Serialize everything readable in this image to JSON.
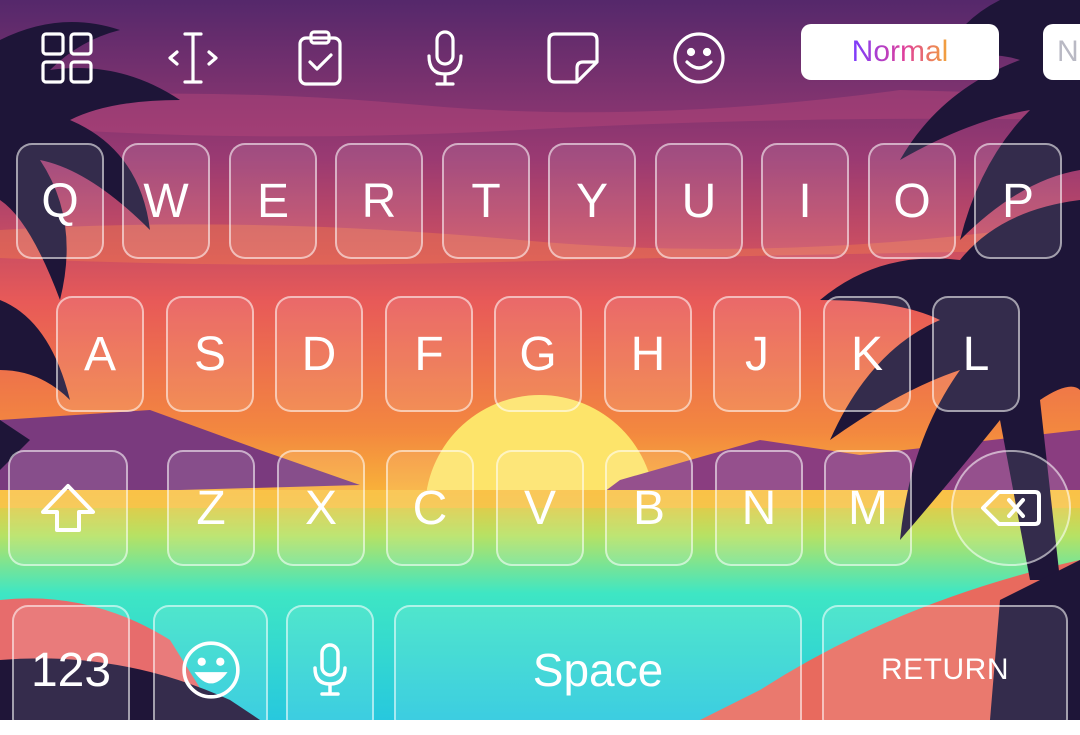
{
  "toolbar": {
    "icons": [
      "apps-grid-icon",
      "text-cursor-icon",
      "clipboard-check-icon",
      "microphone-icon",
      "sticker-icon",
      "smiley-icon"
    ],
    "style_options": [
      "Normal",
      "N"
    ]
  },
  "keyboard": {
    "row1": [
      "Q",
      "W",
      "E",
      "R",
      "T",
      "Y",
      "U",
      "I",
      "O",
      "P"
    ],
    "row2": [
      "A",
      "S",
      "D",
      "F",
      "G",
      "H",
      "J",
      "K",
      "L"
    ],
    "row3": [
      "Z",
      "X",
      "C",
      "V",
      "B",
      "N",
      "M"
    ],
    "numbers_label": "123",
    "space_label": "Space",
    "return_label": "RETURN"
  },
  "colors": {
    "sky_top": "#5a2a6e",
    "sky_mid": "#e25c5c",
    "horizon": "#f7a13a",
    "sun": "#fde96a",
    "sea": "#37e3c6",
    "palm": "#1e1538"
  }
}
